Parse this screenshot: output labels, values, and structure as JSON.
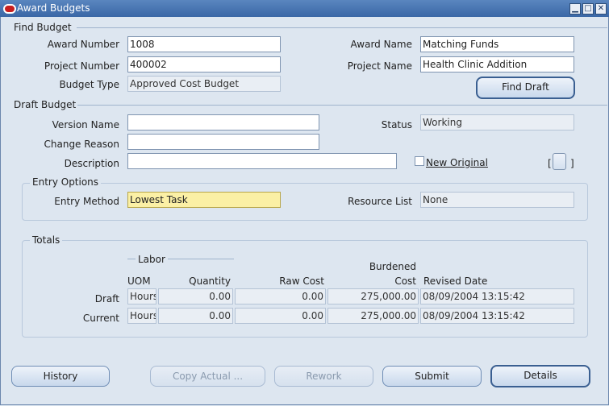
{
  "window": {
    "title": "Award Budgets"
  },
  "find_budget": {
    "section": "Find Budget",
    "award_number_label": "Award Number",
    "award_number": "1008",
    "project_number_label": "Project Number",
    "project_number": "400002",
    "budget_type_label": "Budget Type",
    "budget_type": "Approved Cost Budget",
    "award_name_label": "Award Name",
    "award_name": "Matching Funds",
    "project_name_label": "Project Name",
    "project_name": "Health Clinic Addition",
    "find_draft_button": "Find Draft"
  },
  "draft_budget": {
    "section": "Draft Budget",
    "version_name_label": "Version Name",
    "version_name": "",
    "change_reason_label": "Change Reason",
    "change_reason": "",
    "description_label": "Description",
    "description": "",
    "status_label": "Status",
    "status": "Working",
    "new_original_label": "New Original",
    "bracket_left": "[",
    "bracket_right": "]"
  },
  "entry_options": {
    "section": "Entry Options",
    "entry_method_label": "Entry Method",
    "entry_method": "Lowest Task",
    "resource_list_label": "Resource List",
    "resource_list": "None"
  },
  "totals": {
    "section": "Totals",
    "labor_label": "Labor",
    "columns": {
      "uom": "UOM",
      "quantity": "Quantity",
      "raw_cost": "Raw Cost",
      "burdened_cost_line1": "Burdened",
      "burdened_cost_line2": "Cost",
      "revised_date": "Revised Date"
    },
    "rows": [
      {
        "label": "Draft",
        "uom": "Hours",
        "quantity": "0.00",
        "raw_cost": "0.00",
        "burdened_cost": "275,000.00",
        "revised_date": "08/09/2004 13:15:42"
      },
      {
        "label": "Current",
        "uom": "Hours",
        "quantity": "0.00",
        "raw_cost": "0.00",
        "burdened_cost": "275,000.00",
        "revised_date": "08/09/2004 13:15:42"
      }
    ]
  },
  "buttons": {
    "history": "History",
    "copy_actual": "Copy Actual ...",
    "rework": "Rework",
    "submit": "Submit",
    "details": "Details"
  }
}
